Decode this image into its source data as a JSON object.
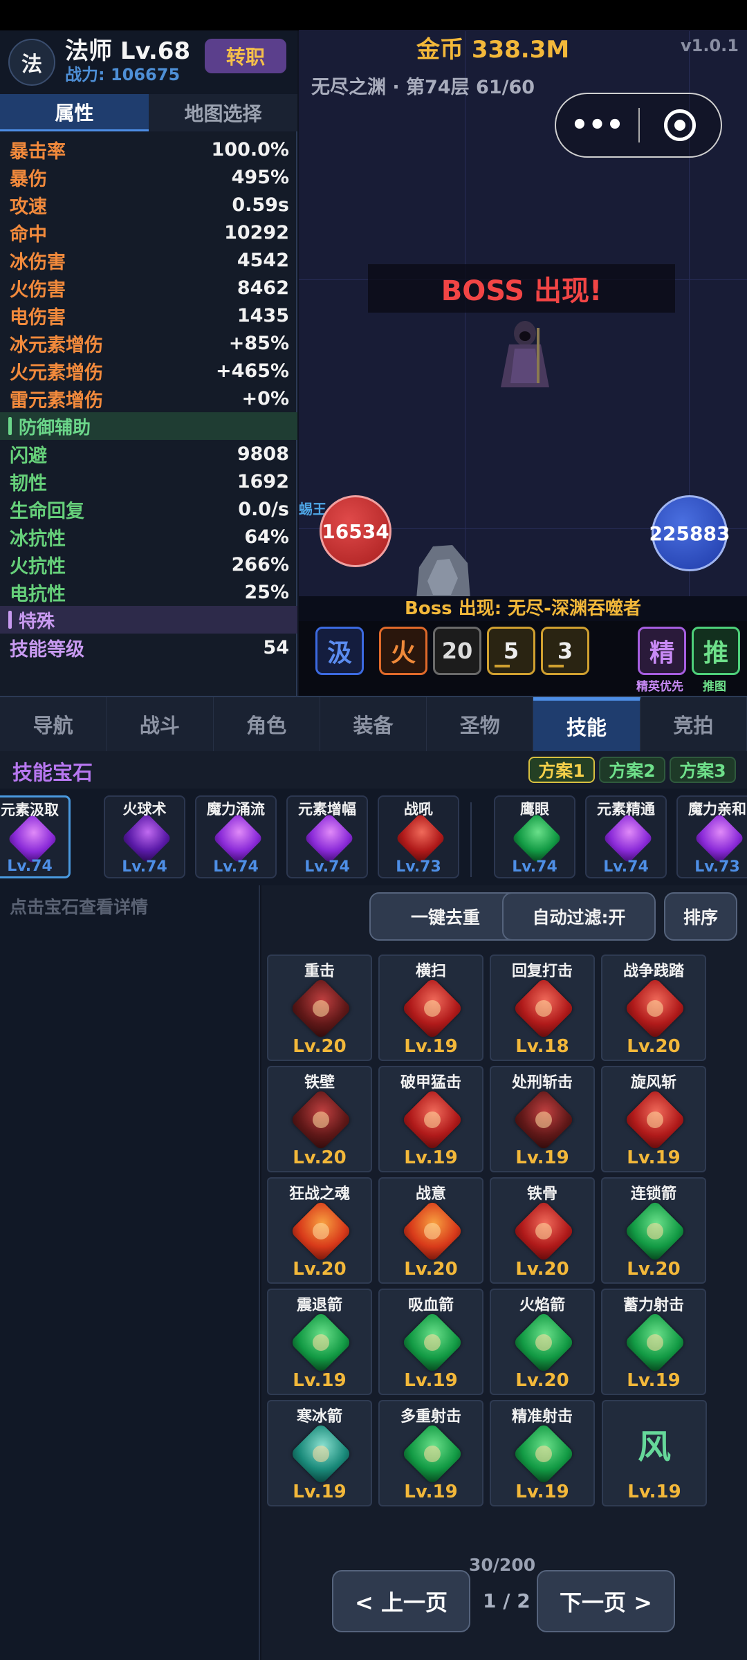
{
  "player": {
    "class_badge": "法",
    "name": "法师 Lv.68",
    "power": "战力: 106675",
    "job_change": "转职"
  },
  "left_tabs": [
    "属性",
    "地图选择"
  ],
  "stats": [
    {
      "k": "暴击率",
      "v": "100.0%"
    },
    {
      "k": "暴伤",
      "v": "495%"
    },
    {
      "k": "攻速",
      "v": "0.59s"
    },
    {
      "k": "命中",
      "v": "10292"
    },
    {
      "k": "冰伤害",
      "v": "4542"
    },
    {
      "k": "火伤害",
      "v": "8462"
    },
    {
      "k": "电伤害",
      "v": "1435"
    },
    {
      "k": "冰元素增伤",
      "v": "+85%"
    },
    {
      "k": "火元素增伤",
      "v": "+465%"
    },
    {
      "k": "雷元素增伤",
      "v": "+0%"
    }
  ],
  "defense_section": "防御辅助",
  "defense": [
    {
      "k": "闪避",
      "v": "9808"
    },
    {
      "k": "韧性",
      "v": "1692"
    },
    {
      "k": "生命回复",
      "v": "0.0/s"
    },
    {
      "k": "冰抗性",
      "v": "64%"
    },
    {
      "k": "火抗性",
      "v": "266%"
    },
    {
      "k": "电抗性",
      "v": "25%"
    }
  ],
  "special_section": "特殊",
  "special": [
    {
      "k": "技能等级",
      "v": "54"
    }
  ],
  "battle": {
    "gold": "金币 338.3M",
    "version": "v1.0.1",
    "floor": "无尽之渊 · 第74层  61/60",
    "menu_dots": "•••",
    "boss_banner": "BOSS 出现!",
    "enemy_tag": "蜴王",
    "enemy_hp": "16534",
    "player_hp": "225883",
    "boss_msg": "Boss 出现: 无尽-深渊吞噬者",
    "buttons": {
      "ice": "汲",
      "fire": "火",
      "twenty": "20",
      "five": "5",
      "three": "3",
      "elite": "精",
      "push": "推"
    },
    "elite_caption": "精英优先",
    "push_caption": "推图"
  },
  "main_tabs": [
    "导航",
    "战斗",
    "角色",
    "装备",
    "圣物",
    "技能",
    "竞拍"
  ],
  "gems_title": "技能宝石",
  "plans": [
    "方案1",
    "方案2",
    "方案3"
  ],
  "equipped": [
    {
      "name": "元素汲取",
      "lv": "Lv.74"
    },
    {
      "name": "火球术",
      "lv": "Lv.74"
    },
    {
      "name": "魔力涌流",
      "lv": "Lv.74"
    },
    {
      "name": "元素增幅",
      "lv": "Lv.74"
    },
    {
      "name": "战吼",
      "lv": "Lv.73"
    },
    {
      "name": "鹰眼",
      "lv": "Lv.74"
    },
    {
      "name": "元素精通",
      "lv": "Lv.74"
    },
    {
      "name": "魔力亲和",
      "lv": "Lv.73"
    }
  ],
  "info_tip": "点击宝石查看详情",
  "actions": [
    "一键去重",
    "自动过滤:开",
    "排序"
  ],
  "inventory": [
    {
      "name": "重击",
      "lv": "Lv.20",
      "color": "dark"
    },
    {
      "name": "横扫",
      "lv": "Lv.19",
      "color": "red"
    },
    {
      "name": "回复打击",
      "lv": "Lv.18",
      "color": "red"
    },
    {
      "name": "战争践踏",
      "lv": "Lv.20",
      "color": "red"
    },
    {
      "name": "铁壁",
      "lv": "Lv.20",
      "color": "dark"
    },
    {
      "name": "破甲猛击",
      "lv": "Lv.19",
      "color": "red"
    },
    {
      "name": "处刑斩击",
      "lv": "Lv.19",
      "color": "dark"
    },
    {
      "name": "旋风斩",
      "lv": "Lv.19",
      "color": "red"
    },
    {
      "name": "狂战之魂",
      "lv": "Lv.20",
      "color": "orange"
    },
    {
      "name": "战意",
      "lv": "Lv.20",
      "color": "orange"
    },
    {
      "name": "铁骨",
      "lv": "Lv.20",
      "color": "red"
    },
    {
      "name": "连锁箭",
      "lv": "Lv.20",
      "color": "green"
    },
    {
      "name": "震退箭",
      "lv": "Lv.19",
      "color": "green"
    },
    {
      "name": "吸血箭",
      "lv": "Lv.19",
      "color": "green"
    },
    {
      "name": "火焰箭",
      "lv": "Lv.20",
      "color": "green"
    },
    {
      "name": "蓄力射击",
      "lv": "Lv.19",
      "color": "green"
    },
    {
      "name": "寒冰箭",
      "lv": "Lv.19",
      "color": "teal"
    },
    {
      "name": "多重射击",
      "lv": "Lv.19",
      "color": "green"
    },
    {
      "name": "精准射击",
      "lv": "Lv.19",
      "color": "green"
    }
  ],
  "wind_card": {
    "glyph": "风",
    "lv": "Lv.19"
  },
  "gem_count": "30/200",
  "pager": {
    "prev": "< 上一页",
    "indicator": "1 / 2",
    "next": "下一页 >"
  }
}
